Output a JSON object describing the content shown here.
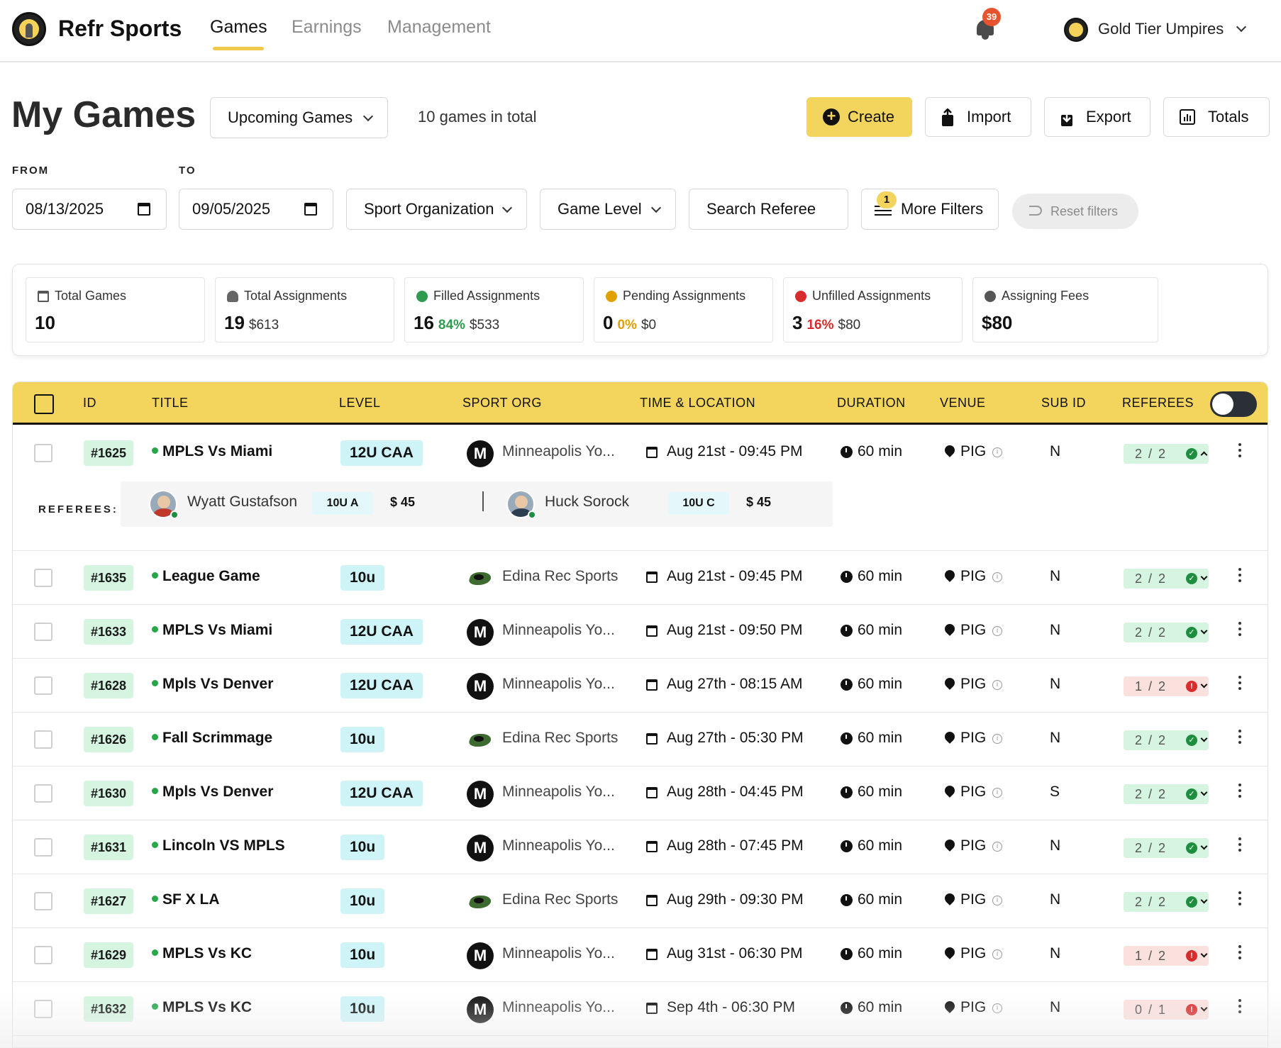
{
  "app": {
    "brand": "Refr Sports",
    "nav_tabs": [
      {
        "label": "Games",
        "active": true
      },
      {
        "label": "Earnings",
        "active": false
      },
      {
        "label": "Management",
        "active": false
      }
    ],
    "notifications_count": "39",
    "user_name": "Gold Tier Umpires",
    "accent_color": "#f3d45d"
  },
  "header": {
    "title": "My Games",
    "view_select": "Upcoming Games",
    "total_text": "10 games in total",
    "buttons": {
      "create": "Create",
      "import": "Import",
      "export": "Export",
      "totals": "Totals"
    }
  },
  "filters": {
    "from_label": "FROM",
    "to_label": "TO",
    "from_date": "08/13/2025",
    "to_date": "09/05/2025",
    "sport_org": "Sport Organization",
    "game_level": "Game Level",
    "search_referee": "Search Referee",
    "more_filters": "More Filters",
    "more_filters_count": "1",
    "reset": "Reset filters"
  },
  "stats": [
    {
      "label": "Total Games",
      "value": "10",
      "pct": "",
      "amount": "",
      "icon": "calendar-icon",
      "color": "#333333"
    },
    {
      "label": "Total Assignments",
      "value": "19",
      "pct": "",
      "amount": "$613",
      "icon": "users-icon",
      "color": "#333333"
    },
    {
      "label": "Filled Assignments",
      "value": "16",
      "pct": "84%",
      "amount": "$533",
      "icon": "check-circle-icon",
      "color": "#2e9b4e"
    },
    {
      "label": "Pending Assignments",
      "value": "0",
      "pct": "0%",
      "amount": "$0",
      "icon": "clock-circle-icon",
      "color": "#e0a100"
    },
    {
      "label": "Unfilled Assignments",
      "value": "3",
      "pct": "16%",
      "amount": "$80",
      "icon": "alert-circle-icon",
      "color": "#d92c2c"
    },
    {
      "label": "Assigning Fees",
      "value": "$80",
      "pct": "",
      "amount": "",
      "icon": "dollar-circle-icon",
      "color": "#333333"
    }
  ],
  "table": {
    "columns": [
      "ID",
      "TITLE",
      "LEVEL",
      "SPORT ORG",
      "TIME & LOCATION",
      "DURATION",
      "VENUE",
      "SUB ID",
      "REFEREES"
    ],
    "referees_label": "REFEREES:",
    "rows": [
      {
        "id": "#1625",
        "title": "MPLS Vs Miami",
        "level": "12U CAA",
        "org": "Minneapolis Yo...",
        "org_logo": "mpls",
        "time": "Aug 21st - 09:45 PM",
        "duration": "60 min",
        "venue": "PIG",
        "sub_id": "N",
        "refs": "2 / 2",
        "ref_status": "ok",
        "expanded": true
      },
      {
        "id": "#1635",
        "title": "League Game",
        "level": "10u",
        "org": "Edina Rec Sports",
        "org_logo": "edina",
        "time": "Aug 21st - 09:45 PM",
        "duration": "60 min",
        "venue": "PIG",
        "sub_id": "N",
        "refs": "2 / 2",
        "ref_status": "ok"
      },
      {
        "id": "#1633",
        "title": "MPLS Vs Miami",
        "level": "12U CAA",
        "org": "Minneapolis Yo...",
        "org_logo": "mpls",
        "time": "Aug 21st - 09:50 PM",
        "duration": "60 min",
        "venue": "PIG",
        "sub_id": "N",
        "refs": "2 / 2",
        "ref_status": "ok"
      },
      {
        "id": "#1628",
        "title": "Mpls Vs Denver",
        "level": "12U CAA",
        "org": "Minneapolis Yo...",
        "org_logo": "mpls",
        "time": "Aug 27th - 08:15 AM",
        "duration": "60 min",
        "venue": "PIG",
        "sub_id": "N",
        "refs": "1 / 2",
        "ref_status": "bad"
      },
      {
        "id": "#1626",
        "title": "Fall Scrimmage",
        "level": "10u",
        "org": "Edina Rec Sports",
        "org_logo": "edina",
        "time": "Aug 27th - 05:30 PM",
        "duration": "60 min",
        "venue": "PIG",
        "sub_id": "N",
        "refs": "2 / 2",
        "ref_status": "ok"
      },
      {
        "id": "#1630",
        "title": "Mpls Vs Denver",
        "level": "12U CAA",
        "org": "Minneapolis Yo...",
        "org_logo": "mpls",
        "time": "Aug 28th - 04:45 PM",
        "duration": "60 min",
        "venue": "PIG",
        "sub_id": "S",
        "refs": "2 / 2",
        "ref_status": "ok"
      },
      {
        "id": "#1631",
        "title": "Lincoln VS MPLS",
        "level": "10u",
        "org": "Minneapolis Yo...",
        "org_logo": "mpls",
        "time": "Aug 28th - 07:45 PM",
        "duration": "60 min",
        "venue": "PIG",
        "sub_id": "N",
        "refs": "2 / 2",
        "ref_status": "ok"
      },
      {
        "id": "#1627",
        "title": "SF X LA",
        "level": "10u",
        "org": "Edina Rec Sports",
        "org_logo": "edina",
        "time": "Aug 29th - 09:30 PM",
        "duration": "60 min",
        "venue": "PIG",
        "sub_id": "N",
        "refs": "2 / 2",
        "ref_status": "ok"
      },
      {
        "id": "#1629",
        "title": "MPLS Vs KC",
        "level": "10u",
        "org": "Minneapolis Yo...",
        "org_logo": "mpls",
        "time": "Aug 31st - 06:30 PM",
        "duration": "60 min",
        "venue": "PIG",
        "sub_id": "N",
        "refs": "1 / 2",
        "ref_status": "bad"
      },
      {
        "id": "#1632",
        "title": "MPLS Vs KC",
        "level": "10u",
        "org": "Minneapolis Yo...",
        "org_logo": "mpls",
        "time": "Sep 4th - 06:30 PM",
        "duration": "60 min",
        "venue": "PIG",
        "sub_id": "N",
        "refs": "0 / 1",
        "ref_status": "bad"
      }
    ],
    "expanded_referees": [
      {
        "name": "Wyatt Gustafson",
        "level": "10U A",
        "fee": "$ 45"
      },
      {
        "name": "Huck Sorock",
        "level": "10U C",
        "fee": "$ 45"
      }
    ]
  }
}
